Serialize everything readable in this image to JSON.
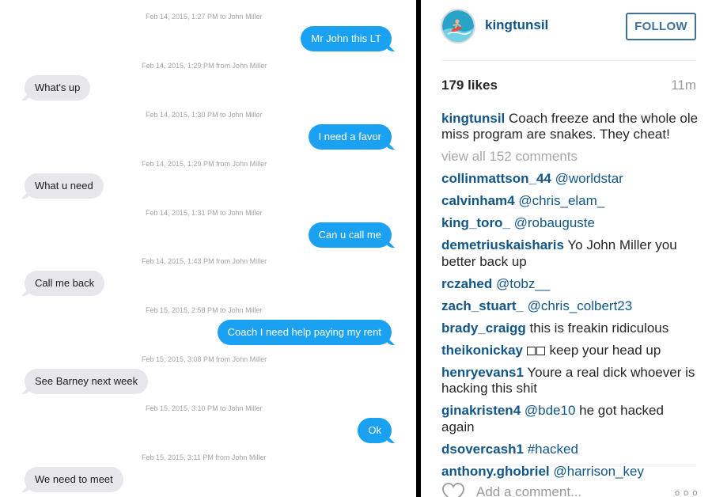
{
  "sms": {
    "messages": [
      {
        "stamp": "Feb 14, 2015, 1:27 PM to John Miller",
        "text": "Mr John this LT",
        "dir": "out"
      },
      {
        "stamp": "Feb 14, 2015, 1:29 PM from John Miller",
        "text": "What's up",
        "dir": "in"
      },
      {
        "stamp": "Feb 14, 2015, 1:30 PM to John Miller",
        "text": "I need a favor",
        "dir": "out"
      },
      {
        "stamp": "Feb 14, 2015, 1:29 PM from John Miller",
        "text": "What u need",
        "dir": "in"
      },
      {
        "stamp": "Feb 14, 2015, 1:31 PM to John Miller",
        "text": "Can u call me",
        "dir": "out"
      },
      {
        "stamp": "Feb 14, 2015, 1:43 PM from John Miller",
        "text": "Call me back",
        "dir": "in"
      },
      {
        "stamp": "Feb 15, 2015, 2:58 PM to John Miller",
        "text": "Coach I need help paying my rent",
        "dir": "out"
      },
      {
        "stamp": "Feb 15, 2015, 3:08 PM from John Miller",
        "text": "See Barney next week",
        "dir": "in"
      },
      {
        "stamp": "Feb 15, 2015, 3:10 PM to John Miller",
        "text": "Ok",
        "dir": "out"
      },
      {
        "stamp": "Feb 15, 2015, 3:11 PM from John Miller",
        "text": "We need to meet",
        "dir": "in"
      }
    ]
  },
  "instagram": {
    "username": "kingtunsil",
    "follow_label": "FOLLOW",
    "likes": "179 likes",
    "age": "11m",
    "caption": {
      "user": "kingtunsil",
      "text": "Coach freeze and the whole ole miss program are snakes. They cheat!"
    },
    "view_all": "view all 152 comments",
    "comments": [
      {
        "user": "collinmattson_44",
        "mention": "@worldstar",
        "text": ""
      },
      {
        "user": "calvinham4",
        "mention": "@chris_elam_",
        "text": ""
      },
      {
        "user": "king_toro_",
        "mention": "@robauguste",
        "text": ""
      },
      {
        "user": "demetriuskaisharis",
        "mention": "",
        "text": "Yo John Miller you better back up"
      },
      {
        "user": "rczahed",
        "mention": "@tobz__",
        "text": ""
      },
      {
        "user": "zach_stuart_",
        "mention": "@chris_colbert23",
        "text": ""
      },
      {
        "user": "brady_craigg",
        "mention": "",
        "text": "this is freakin ridiculous"
      },
      {
        "user": "theikonickay",
        "mention": "",
        "text": "keep your head up"
      },
      {
        "user": "henryevans1",
        "mention": "",
        "text": "Youre a real dick whoever is hacking this shit"
      },
      {
        "user": "ginakristen4",
        "mention": "@bde10",
        "text": "he got hacked again"
      },
      {
        "user": "dsovercash1",
        "mention": "#hacked",
        "text": ""
      },
      {
        "user": "anthony.ghobriel",
        "mention": "@harrison_key",
        "text": ""
      }
    ],
    "add_comment_placeholder": "Add a comment...",
    "more_glyph": "o o o",
    "accent_color": "#125688",
    "follow_color": "#3f729b"
  },
  "colors": {
    "sent_bubble": "#1aa1f1",
    "received_bubble": "#e6e6eb"
  }
}
